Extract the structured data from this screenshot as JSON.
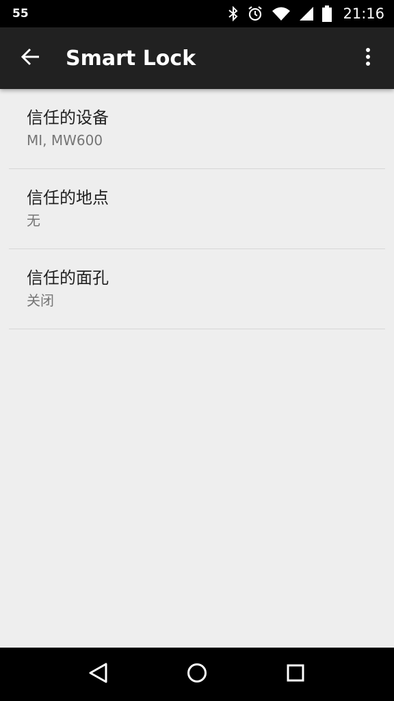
{
  "status_bar": {
    "notification_count": "55",
    "time": "21:16",
    "icons": [
      "bluetooth-icon",
      "alarm-icon",
      "wifi-icon",
      "signal-icon",
      "battery-icon"
    ]
  },
  "app_bar": {
    "title": "Smart Lock",
    "back_icon": "arrow-back-icon",
    "menu_icon": "more-vert-icon"
  },
  "list": [
    {
      "title": "信任的设备",
      "summary": "MI, MW600"
    },
    {
      "title": "信任的地点",
      "summary": "无"
    },
    {
      "title": "信任的面孔",
      "summary": "关闭"
    }
  ],
  "nav_bar": {
    "icons": [
      "back-triangle-icon",
      "home-circle-icon",
      "recents-square-icon"
    ]
  },
  "colors": {
    "status_bar": "#000000",
    "app_bar": "#212121",
    "background": "#eeeeee",
    "title_text": "#212121",
    "summary_text": "#757575"
  }
}
